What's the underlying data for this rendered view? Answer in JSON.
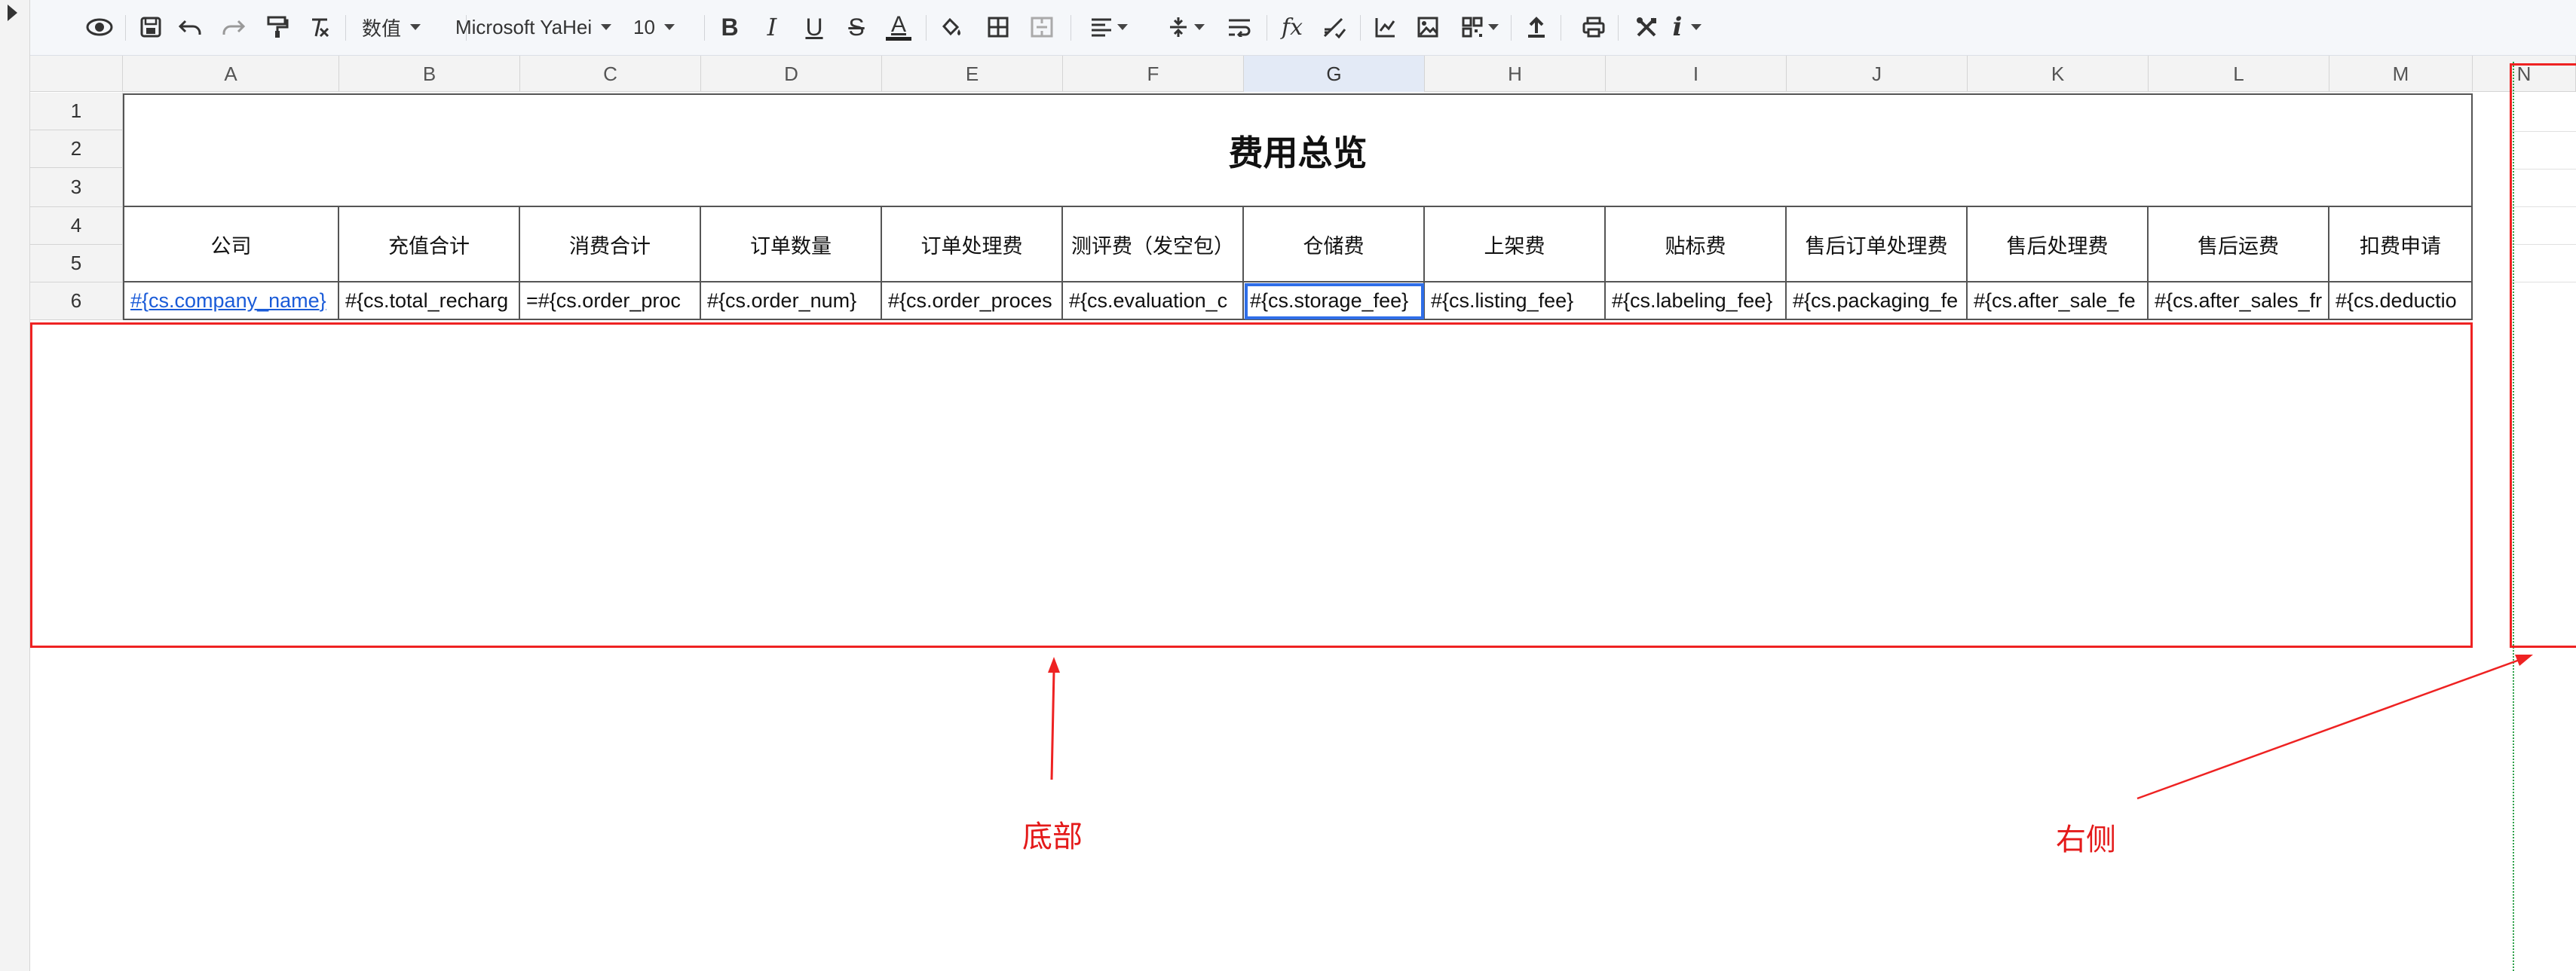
{
  "toolbar": {
    "number_format": "数值",
    "font_family": "Microsoft YaHei",
    "font_size": "10",
    "bold_glyph": "B",
    "italic_glyph": "I",
    "underline_glyph": "U",
    "strike_glyph": "S",
    "fontcolor_glyph": "A",
    "formula_glyph": "fx",
    "info_glyph": "i"
  },
  "columns": [
    "A",
    "B",
    "C",
    "D",
    "E",
    "F",
    "G",
    "H",
    "I",
    "J",
    "K",
    "L",
    "M",
    "N"
  ],
  "rows": [
    "1",
    "2",
    "3",
    "4",
    "5",
    "6"
  ],
  "sheet": {
    "title": "费用总览",
    "headers": [
      "公司",
      "充值合计",
      "消费合计",
      "订单数量",
      "订单处理费",
      "测评费（发空包）",
      "仓储费",
      "上架费",
      "贴标费",
      "售后订单处理费",
      "售后处理费",
      "售后运费",
      "扣费申请"
    ],
    "data": [
      "#{cs.company_name}",
      "#{cs.total_recharg",
      "=#{cs.order_proc",
      "#{cs.order_num}",
      "#{cs.order_proces",
      "#{cs.evaluation_c",
      "#{cs.storage_fee}",
      "#{cs.listing_fee}",
      "#{cs.labeling_fee}",
      "#{cs.packaging_fe",
      "#{cs.after_sale_fe",
      "#{cs.after_sales_fr",
      "#{cs.deductio"
    ]
  },
  "annotations": {
    "bottom_label": "底部",
    "right_label": "右侧"
  },
  "colors": {
    "annotation": "#ee2222",
    "selection": "#2f6ee8",
    "link": "#1a5bd8"
  }
}
